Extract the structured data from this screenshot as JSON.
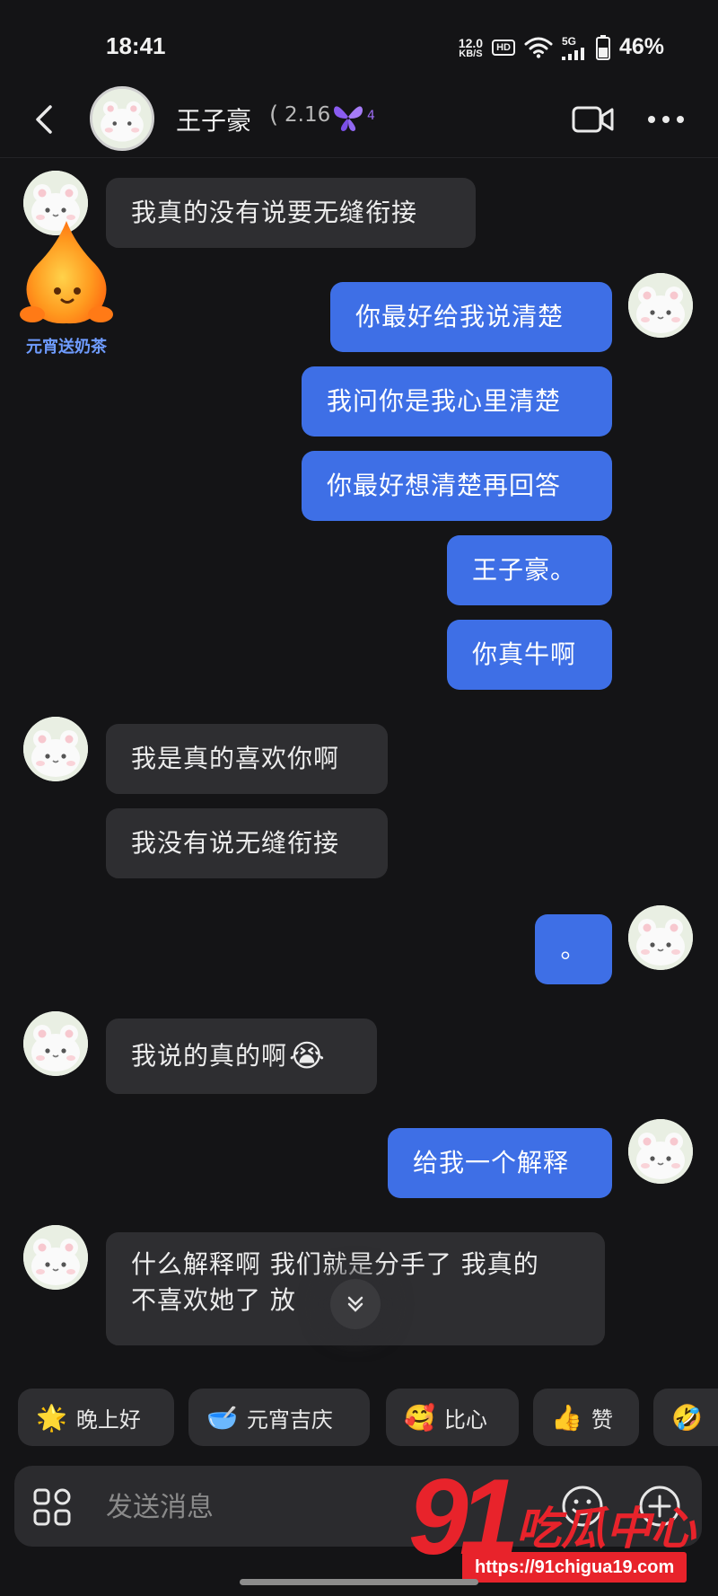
{
  "status_bar": {
    "time": "18:41",
    "net_speed_value": "12.0",
    "net_speed_unit": "KB/S",
    "hd_label": "HD",
    "signal_label": "5G",
    "battery": "46%"
  },
  "header": {
    "contact_name": "王子豪",
    "paren": "(",
    "score": "2.16",
    "level": "4"
  },
  "sticker": {
    "label": "元宵送奶茶"
  },
  "messages": [
    {
      "side": "in",
      "text": "我真的没有说要无缝衔接"
    },
    {
      "side": "out",
      "text": "你最好给我说清楚"
    },
    {
      "side": "out",
      "text": "我问你是我心里清楚"
    },
    {
      "side": "out",
      "text": "你最好想清楚再回答"
    },
    {
      "side": "out",
      "text": "王子豪。"
    },
    {
      "side": "out",
      "text": "你真牛啊"
    },
    {
      "side": "in",
      "text": "我是真的喜欢你啊"
    },
    {
      "side": "in",
      "text": "我没有说无缝衔接"
    },
    {
      "side": "out",
      "text": "。"
    },
    {
      "side": "in",
      "text": "我说的真的啊",
      "emoji": "😭"
    },
    {
      "side": "out",
      "text": "给我一个解释"
    },
    {
      "side": "in",
      "line1": "什么解释啊 我们就是分手了 我真的",
      "line2": "不喜欢她了 放"
    }
  ],
  "quick_replies": [
    {
      "emoji": "🌟",
      "label": "晚上好"
    },
    {
      "emoji": "🥣",
      "label": "元宵吉庆"
    },
    {
      "emoji": "🥰",
      "label": "比心"
    },
    {
      "emoji": "👍",
      "label": "赞"
    },
    {
      "emoji": "🤣",
      "label": ""
    }
  ],
  "input": {
    "placeholder": "发送消息"
  },
  "watermark": {
    "number": "91",
    "brand": "吃瓜中心",
    "url": "https://91chigua19.com"
  },
  "colors": {
    "outgoing": "#3e6fe6",
    "incoming": "#2e2e31",
    "background": "#141416",
    "watermark": "#e8232b"
  }
}
